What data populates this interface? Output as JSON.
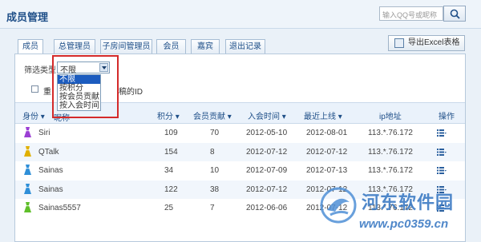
{
  "header": {
    "title": "成员管理",
    "search_placeholder": "输入QQ号或昵称",
    "search_icon": "search-icon"
  },
  "tabs": [
    {
      "label": "成员",
      "active": true
    },
    {
      "label": "总管理员",
      "active": false
    },
    {
      "label": "子房间管理员",
      "active": false
    },
    {
      "label": "会员",
      "active": false
    },
    {
      "label": "嘉宾",
      "active": false
    },
    {
      "label": "退出记录",
      "active": false
    }
  ],
  "toolbar": {
    "export_label": "导出Excel表格",
    "export_icon": "excel-export-icon"
  },
  "filter": {
    "label": "筛选类型",
    "selected": "不限",
    "options": [
      "不限",
      "按积分",
      "按会员贡献",
      "按入会时间"
    ]
  },
  "checkbox_row": {
    "label_left": "重",
    "label_right": "稿的ID"
  },
  "table": {
    "headers": [
      "身份",
      "昵称",
      "积分",
      "会员贡献",
      "入会时间",
      "最近上线",
      "ip地址",
      "操作"
    ],
    "rows": [
      {
        "role_color": "#9b3fd4",
        "nickname": "Siri",
        "points": "109",
        "contribution": "70",
        "join_date": "2012-05-10",
        "last_online": "2012-08-01",
        "ip": "113.*.76.172"
      },
      {
        "role_color": "#e0b000",
        "nickname": "QTalk",
        "points": "154",
        "contribution": "8",
        "join_date": "2012-07-12",
        "last_online": "2012-07-12",
        "ip": "113.*.76.172"
      },
      {
        "role_color": "#2f8fd8",
        "nickname": "Sainas",
        "points": "34",
        "contribution": "10",
        "join_date": "2012-07-09",
        "last_online": "2012-07-13",
        "ip": "113.*.76.172"
      },
      {
        "role_color": "#2f8fd8",
        "nickname": "Sainas",
        "points": "122",
        "contribution": "38",
        "join_date": "2012-07-12",
        "last_online": "2012-07-12",
        "ip": "113.*.76.172"
      },
      {
        "role_color": "#5fbf2a",
        "nickname": "Sainas5557",
        "points": "25",
        "contribution": "7",
        "join_date": "2012-06-06",
        "last_online": "2012-07-12",
        "ip": "113.*.76.172"
      }
    ]
  },
  "watermark": {
    "name": "河东软件园",
    "url": "www.pc0359.cn"
  },
  "colors": {
    "accent": "#1f4f88",
    "highlight": "#d42a2a",
    "header_bg": "#eaf2fb",
    "alt_row": "#f1f6fc"
  }
}
